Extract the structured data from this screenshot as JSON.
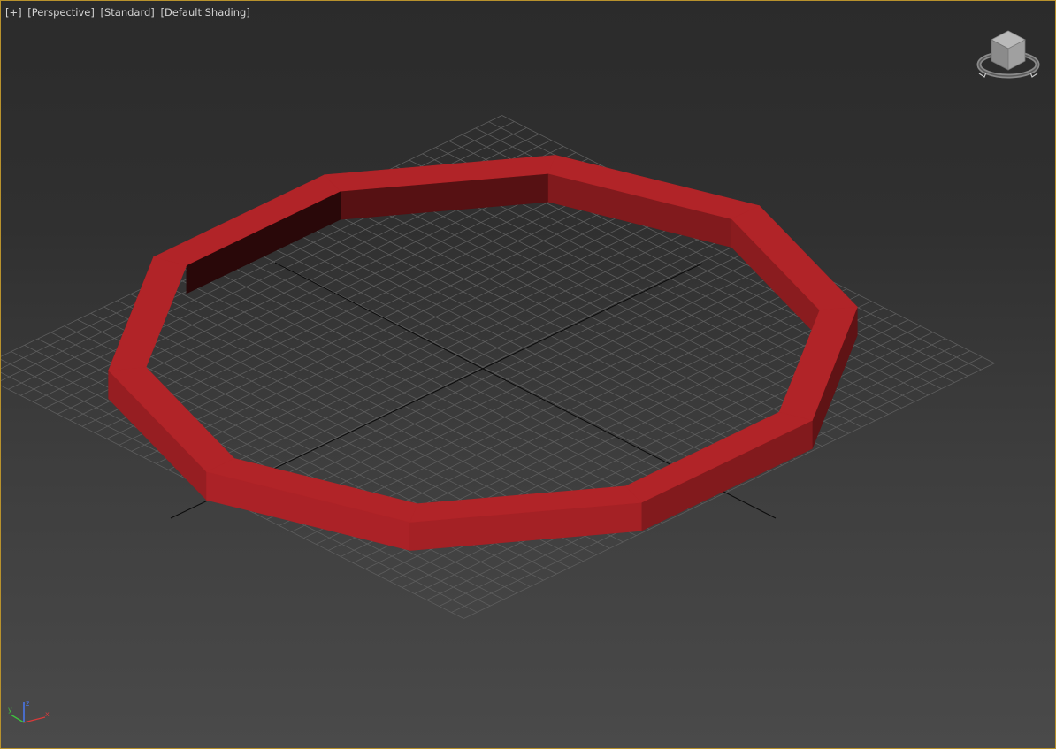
{
  "viewport": {
    "labels": {
      "plus": "[+]",
      "view": "[Perspective]",
      "style": "[Standard]",
      "shading": "[Default Shading]"
    },
    "active_border_color": "#b8922d",
    "object_color": "#a42125"
  },
  "viewcube": {
    "icon": "viewcube-icon"
  },
  "axis_tripod": {
    "icon": "axis-tripod-icon",
    "x_label": "x",
    "y_label": "y",
    "z_label": "z",
    "x_color": "#d83a3a",
    "y_color": "#3fbf3f",
    "z_color": "#4a7bff"
  }
}
